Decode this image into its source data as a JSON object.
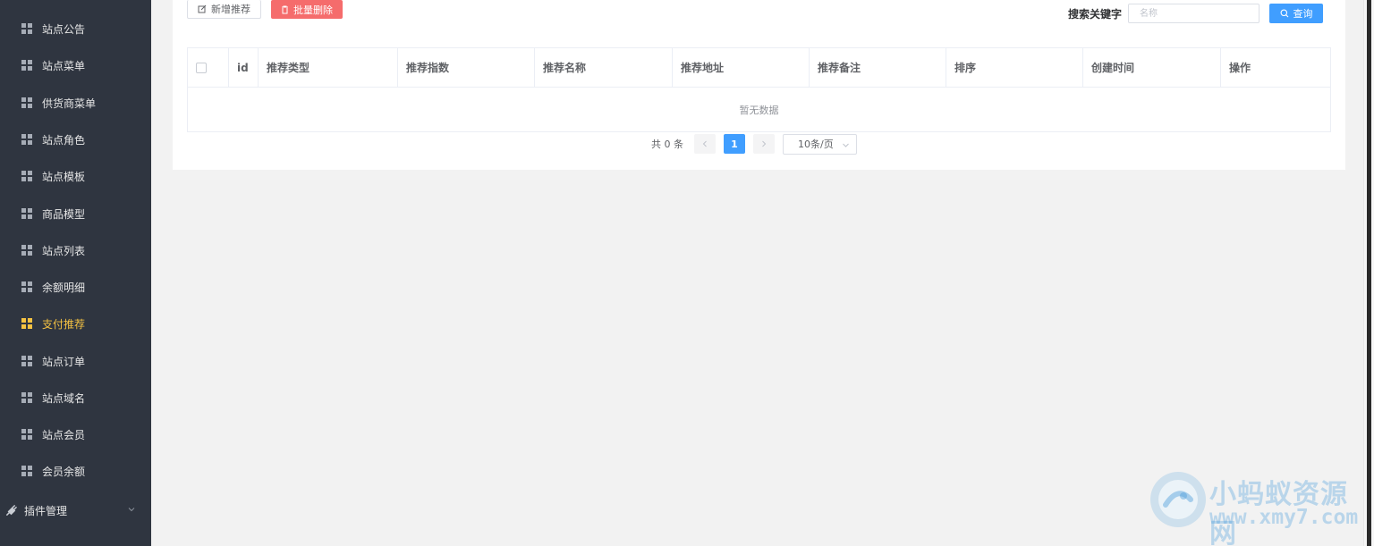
{
  "sidebar": {
    "items": [
      {
        "label": "站点公告",
        "active": false
      },
      {
        "label": "站点菜单",
        "active": false
      },
      {
        "label": "供货商菜单",
        "active": false
      },
      {
        "label": "站点角色",
        "active": false
      },
      {
        "label": "站点模板",
        "active": false
      },
      {
        "label": "商品模型",
        "active": false
      },
      {
        "label": "站点列表",
        "active": false
      },
      {
        "label": "余额明细",
        "active": false
      },
      {
        "label": "支付推荐",
        "active": true
      },
      {
        "label": "站点订单",
        "active": false
      },
      {
        "label": "站点域名",
        "active": false
      },
      {
        "label": "站点会员",
        "active": false
      },
      {
        "label": "会员余额",
        "active": false
      }
    ],
    "plugin_group": {
      "label": "插件管理",
      "icon": "plug-icon",
      "expand_icon": "chevron-down-icon"
    },
    "item_icon": "grid-icon",
    "colors": {
      "background": "#2f3540",
      "text": "#e6e6e6",
      "active": "#f5c242"
    }
  },
  "toolbar": {
    "add_label": "新增推荐",
    "add_icon": "edit-icon",
    "delete_label": "批量删除",
    "delete_icon": "trash-icon",
    "search_label": "搜索关键字",
    "search_placeholder": "名称",
    "search_value": "",
    "query_label": "查询",
    "query_icon": "search-icon"
  },
  "table": {
    "columns": [
      "",
      "id",
      "推荐类型",
      "推荐指数",
      "推荐名称",
      "推荐地址",
      "推荐备注",
      "排序",
      "创建时间",
      "操作"
    ],
    "rows": [],
    "empty_text": "暂无数据"
  },
  "pagination": {
    "total_text": "共 0 条",
    "current_page": "1",
    "page_size": "10条/页"
  },
  "watermark": {
    "title": "小蚂蚁资源网",
    "url": "www.xmy7.com"
  },
  "colors": {
    "primary": "#409eff",
    "danger": "#f56c6c",
    "page_bg": "#f2f2f2"
  }
}
